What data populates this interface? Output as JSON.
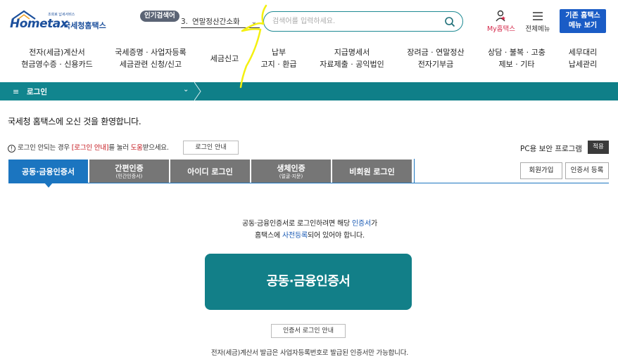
{
  "header": {
    "logo_text": "Hometax",
    "logo_org": "국세청홈택스",
    "logo_small": "조회로 납세서비스",
    "popular_badge": "인기검색어",
    "popular_item_num": "3.",
    "popular_item_text": "연말정산간소화",
    "search_placeholder": "검색어를 입력하세요.",
    "my_hometax": "My홈택스",
    "all_menu": "전체메뉴",
    "old_hometax_line1": "기존 홈택스",
    "old_hometax_line2": "메뉴 보기"
  },
  "gnb": [
    {
      "line1": "전자(세금)계산서",
      "line2": "현금영수증 · 신용카드"
    },
    {
      "line1": "국세증명 · 사업자등록",
      "line2": "세금관련 신청/신고"
    },
    {
      "line1": "세금신고",
      "line2": ""
    },
    {
      "line1": "납부",
      "line2": "고지 · 환급"
    },
    {
      "line1": "지급명세서",
      "line2": "자료제출 · 공익법인"
    },
    {
      "line1": "장려금 · 연말정산",
      "line2": "전자기부금"
    },
    {
      "line1": "상담 · 불복 · 고충",
      "line2": "제보 · 기타"
    },
    {
      "line1": "세무대리",
      "line2": "납세관리"
    }
  ],
  "breadcrumb": {
    "label": "로그인"
  },
  "welcome": "국세청 홈택스에 오신 것을 환영합니다.",
  "notice": {
    "prefix": "로그인 안되는 경우 ",
    "link1": "[로그인 안내]",
    "middle": "를 눌러 ",
    "link2": "도움",
    "suffix": "받으세요.",
    "button": "로그인 안내"
  },
  "pc_security": {
    "label": "PC용 보안 프로그램",
    "button": "적용"
  },
  "tabs": [
    {
      "main": "공동·금융인증서",
      "sub": ""
    },
    {
      "main": "간편인증",
      "sub": "(민간인증서)"
    },
    {
      "main": "아이디 로그인",
      "sub": ""
    },
    {
      "main": "생체인증",
      "sub": "(얼굴·지문)"
    },
    {
      "main": "비회원 로그인",
      "sub": ""
    }
  ],
  "side_buttons": {
    "join": "회원가입",
    "cert_register": "인증서 등록"
  },
  "description": {
    "line1_a": "공동·금융인증서로 로그인하려면 해당 ",
    "line1_hl": "인증서",
    "line1_b": "가",
    "line2_a": "홈택스에 ",
    "line2_hl": "사전등록",
    "line2_b": "되어 있어야 합니다."
  },
  "main_button": "공동·금융인증서",
  "cert_guide_button": "인증서 로그인 안내",
  "footnote": "전자(세금)계산서 발급은 사업자등록번호로 발급된 인증서만 가능합니다.",
  "colors": {
    "teal": "#127f88",
    "tab_active": "#1b75c0",
    "tab_inactive": "#767676",
    "brand_blue": "#1b4f9c",
    "my_red": "#d52b4c",
    "old_btn_blue": "#1a5cc6"
  }
}
